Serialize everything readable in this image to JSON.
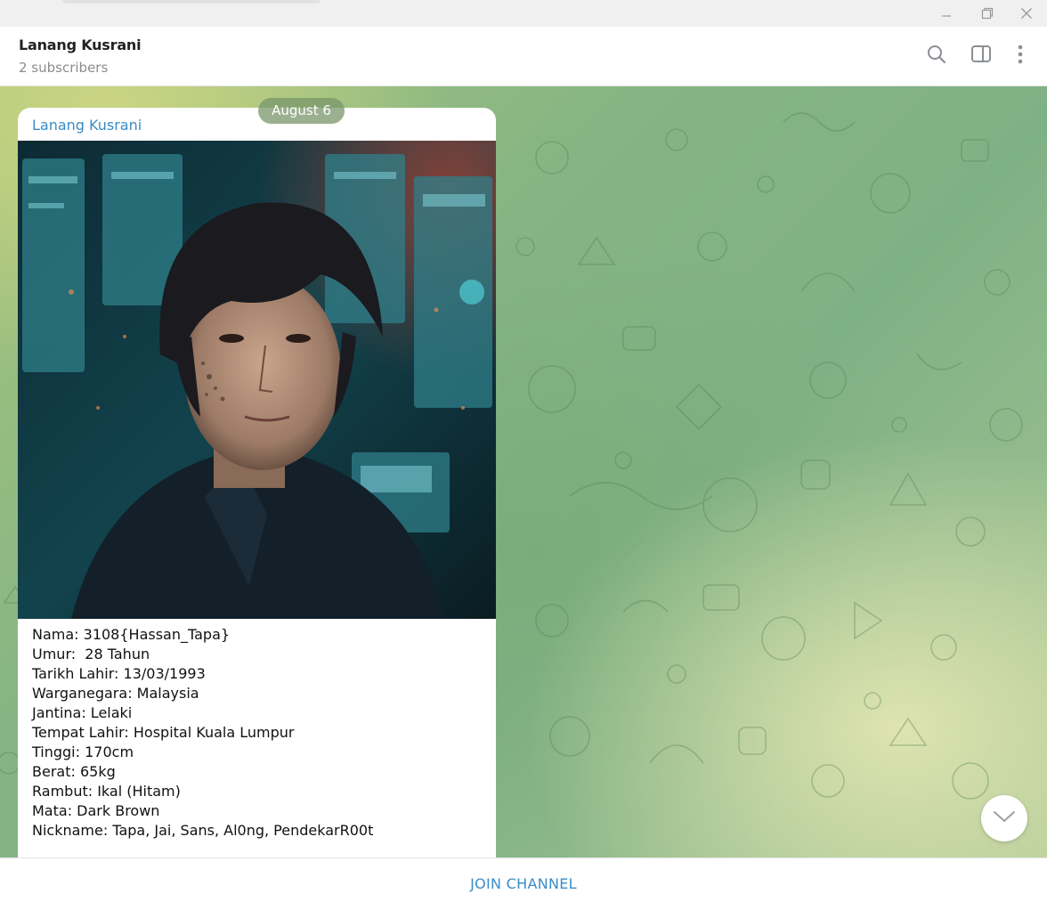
{
  "window": {
    "minimize_icon": "minimize-icon",
    "maximize_icon": "restore-icon",
    "close_icon": "close-icon"
  },
  "header": {
    "title": "Lanang Kusrani",
    "subtitle": "2 subscribers",
    "icons": [
      "search-icon",
      "sidebar-panel-icon",
      "more-vertical-icon"
    ]
  },
  "chat": {
    "date_label": "August 6",
    "message": {
      "author": "Lanang Kusrani",
      "photo_icon": "portrait-photo",
      "lines": [
        "Nama: 3108{Hassan_Tapa}",
        "Umur:  28 Tahun",
        "Tarikh Lahir: 13/03/1993",
        "Warganegara: Malaysia",
        "Jantina: Lelaki",
        "Tempat Lahir: Hospital Kuala Lumpur",
        "Tinggi: 170cm",
        "Berat: 65kg",
        "Rambut: Ikal (Hitam)",
        "Mata: Dark Brown",
        "Nickname: Tapa, Jai, Sans, Al0ng, PendekarR00t"
      ]
    },
    "scroll_icon": "chevron-down-icon"
  },
  "footer": {
    "join_label": "JOIN CHANNEL"
  },
  "colors": {
    "accent": "#3a8cc6",
    "chat_bg": "#86b583",
    "date_pill": "#7a9669"
  }
}
